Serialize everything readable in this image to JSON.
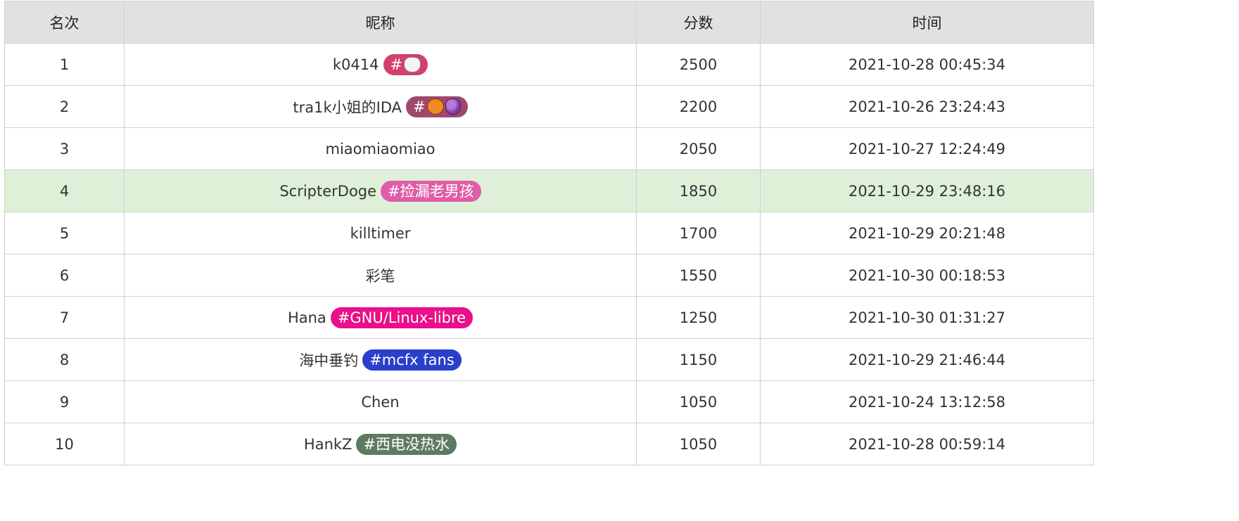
{
  "table": {
    "headers": {
      "rank": "名次",
      "name": "昵称",
      "score": "分数",
      "time": "时间"
    },
    "rows": [
      {
        "rank": "1",
        "name": "k0414",
        "tag": "#",
        "tag_icons": [
          "cat-face-icon"
        ],
        "tag_color": "#d1416b",
        "score": "2500",
        "time": "2021-10-28 00:45:34",
        "highlight": false
      },
      {
        "rank": "2",
        "name": "tra1k小姐的IDA",
        "tag": "#",
        "tag_icons": [
          "jack-o-lantern-icon",
          "grapes-icon"
        ],
        "tag_color": "#a0486c",
        "score": "2200",
        "time": "2021-10-26 23:24:43",
        "highlight": false
      },
      {
        "rank": "3",
        "name": "miaomiaomiao",
        "tag": "",
        "tag_icons": [],
        "tag_color": "",
        "score": "2050",
        "time": "2021-10-27 12:24:49",
        "highlight": false
      },
      {
        "rank": "4",
        "name": "ScripterDoge",
        "tag": "#捡漏老男孩",
        "tag_icons": [],
        "tag_color": "#e05ca8",
        "score": "1850",
        "time": "2021-10-29 23:48:16",
        "highlight": true
      },
      {
        "rank": "5",
        "name": "killtimer",
        "tag": "",
        "tag_icons": [],
        "tag_color": "",
        "score": "1700",
        "time": "2021-10-29 20:21:48",
        "highlight": false
      },
      {
        "rank": "6",
        "name": "彩笔",
        "tag": "",
        "tag_icons": [],
        "tag_color": "",
        "score": "1550",
        "time": "2021-10-30 00:18:53",
        "highlight": false
      },
      {
        "rank": "7",
        "name": "Hana",
        "tag": "#GNU/Linux-libre",
        "tag_icons": [],
        "tag_color": "#ea0f8a",
        "score": "1250",
        "time": "2021-10-30 01:31:27",
        "highlight": false
      },
      {
        "rank": "8",
        "name": "海中垂钓",
        "tag": "#mcfx fans",
        "tag_icons": [],
        "tag_color": "#2a3fcc",
        "score": "1150",
        "time": "2021-10-29 21:46:44",
        "highlight": false
      },
      {
        "rank": "9",
        "name": "Chen",
        "tag": "",
        "tag_icons": [],
        "tag_color": "",
        "score": "1050",
        "time": "2021-10-24 13:12:58",
        "highlight": false
      },
      {
        "rank": "10",
        "name": "HankZ",
        "tag": "#西电没热水",
        "tag_icons": [],
        "tag_color": "#5e7b61",
        "score": "1050",
        "time": "2021-10-28 00:59:14",
        "highlight": false
      }
    ]
  },
  "colors": {
    "header_bg": "#e1e1e1",
    "highlight_bg": "#dff0d8",
    "border": "#d0d0d0"
  }
}
